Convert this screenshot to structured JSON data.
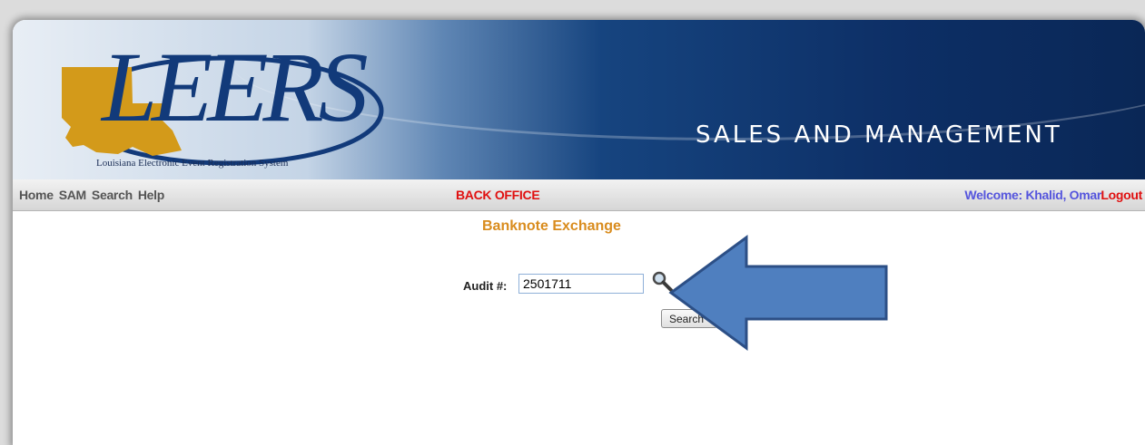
{
  "header": {
    "logo_text": "LEERS",
    "logo_subtitle": "Louisiana Electronic Event Registration System",
    "app_title": "SALES AND MANAGEMENT"
  },
  "nav": {
    "links": [
      "Home",
      "SAM",
      "Search",
      "Help"
    ],
    "office": "BACK OFFICE",
    "welcome": "Welcome: Khalid, Omar",
    "logout": "Logout"
  },
  "main": {
    "heading": "Banknote Exchange",
    "audit_label": "Audit #:",
    "audit_value": "2501711",
    "search_button": "Search"
  },
  "colors": {
    "brand_blue": "#0d2f66",
    "heading_orange": "#d98c1e",
    "alert_red": "#e01010",
    "welcome_blue": "#5555dd",
    "annotation_arrow": "#4f7fbf",
    "louisiana_gold": "#d39a1a"
  },
  "icons": {
    "search": "magnifier-icon",
    "annotation": "left-arrow-icon"
  }
}
